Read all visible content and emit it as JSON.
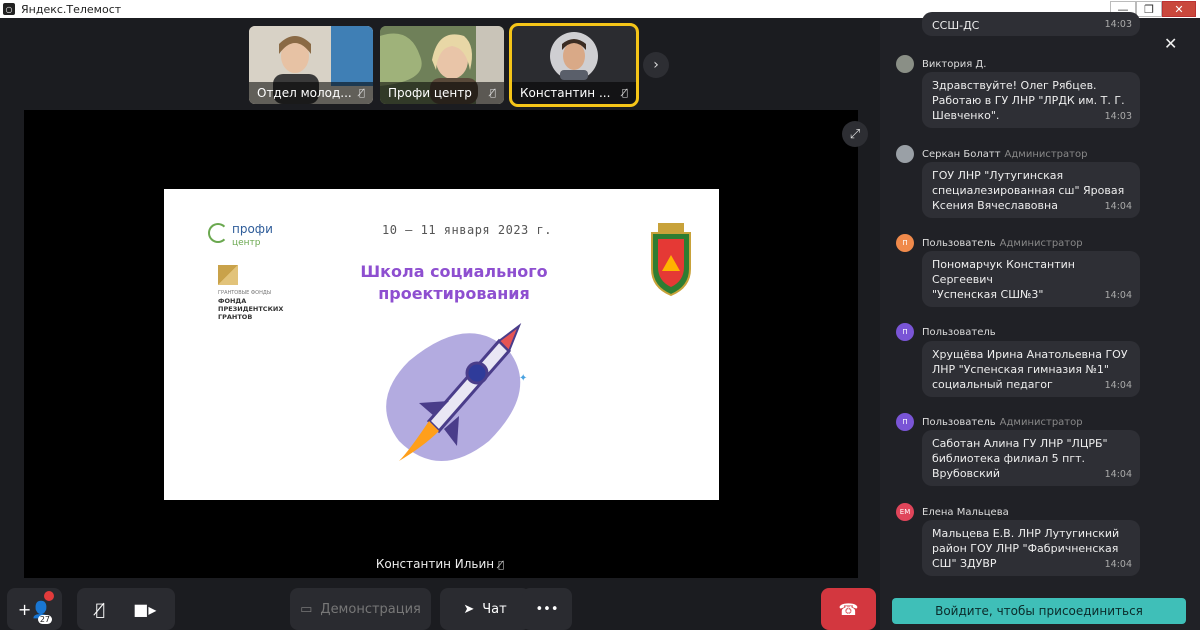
{
  "window": {
    "title": "Яндекс.Телемост",
    "minimize": "—",
    "maximize": "❐",
    "close": "✕"
  },
  "participants": [
    {
      "name": "Отдел молод...",
      "bg": "#c8c0b0"
    },
    {
      "name": "Профи центр",
      "bg": "#7c8a63"
    },
    {
      "name": "Константин ...",
      "bg": "#b5b5b8",
      "active": true
    }
  ],
  "stage": {
    "speaker": "Константин Ильин",
    "slide": {
      "date": "10 – 11 января 2023 г.",
      "headline_1": "Школа социального",
      "headline_2": "проектирования",
      "brand1": "профи",
      "brand1_sub": "центр",
      "brand2_line1": "ГРАНТОВЫЕ ФОНДЫ",
      "brand2_line2": "ФОНДА",
      "brand2_line3": "ПРЕЗИДЕНТСКИХ",
      "brand2_line4": "ГРАНТОВ"
    }
  },
  "toolbar": {
    "invite_count": "27",
    "demo_label": "Демонстрация",
    "chat_label": "Чат",
    "more_label": "•••"
  },
  "chat": {
    "top_partial": {
      "text": "ССШ-ДС",
      "time": "14:03"
    },
    "messages": [
      {
        "author": "Виктория Д.",
        "role": "",
        "avatar": "",
        "avatar_color": "#8a8f86",
        "lines": [
          "Здравствуйте! Олег Рябцев.",
          "Работаю в ГУ ЛНР \"ЛРДК им. Т. Г.",
          "Шевченко\"."
        ],
        "time": "14:03"
      },
      {
        "author": "Серкан Болатт",
        "role": "Администратор",
        "avatar": "",
        "avatar_color": "#9aa0a6",
        "lines": [
          "ГОУ ЛНР \"Лутугинская",
          "специалезированная сш\" Яровая",
          "Ксения Вячеславовна"
        ],
        "time": "14:04"
      },
      {
        "author": "Пользователь",
        "role": "Администратор",
        "avatar": "П",
        "avatar_color": "#f08a4b",
        "lines": [
          "Пономарчук Константин",
          "Сергеевич",
          "\"Успенская СШ№3\""
        ],
        "time": "14:04"
      },
      {
        "author": "Пользователь",
        "role": "",
        "avatar": "П",
        "avatar_color": "#7a55d6",
        "lines": [
          "Хрущёва Ирина Анатольевна ГОУ",
          "ЛНР \"Успенская гимназия №1\"",
          "социальный педагог"
        ],
        "time": "14:04"
      },
      {
        "author": "Пользователь",
        "role": "Администратор",
        "avatar": "П",
        "avatar_color": "#7a55d6",
        "lines": [
          "Саботан Алина  ГУ ЛНР \"ЛЦРБ\"",
          "библиотека филиал 5  пгт.",
          "Врубовский"
        ],
        "time": "14:04"
      },
      {
        "author": "Елена Мальцева",
        "role": "",
        "avatar": "ЕМ",
        "avatar_color": "#e0455a",
        "lines": [
          "Мальцева Е.В. ЛНР Лутугинский",
          "район ГОУ ЛНР \"Фабричненская",
          "СШ\" ЗДУВР"
        ],
        "time": "14:04"
      }
    ],
    "join_label": "Войдите, чтобы присоединиться"
  }
}
